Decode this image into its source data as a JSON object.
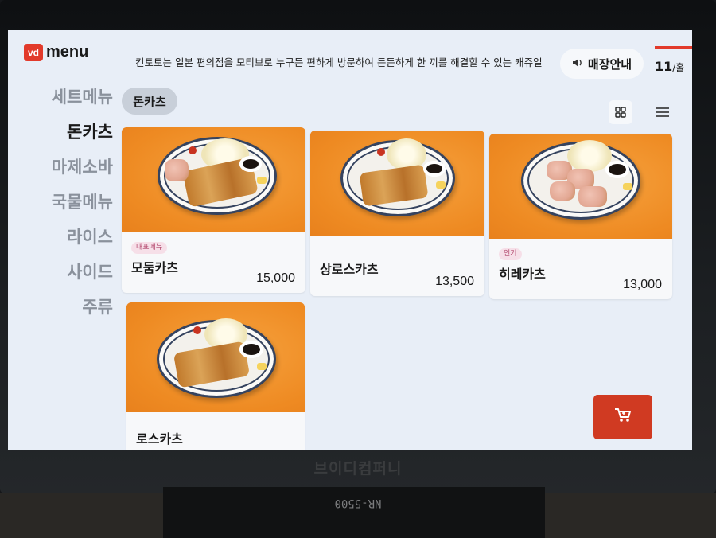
{
  "header": {
    "logo_badge": "vd",
    "logo_word": "menu",
    "notice": "킨토토는 일본 편의점을 모티브로 누구든 편하게 방문하여 든든하게 한 끼를 해결할 수 있는 캐쥬얼",
    "store_info_label": "매장안내",
    "table_number": "11",
    "table_suffix": "/홀"
  },
  "sidebar": {
    "items": [
      {
        "label": "세트메뉴"
      },
      {
        "label": "돈카츠"
      },
      {
        "label": "마제소바"
      },
      {
        "label": "국물메뉴"
      },
      {
        "label": "라이스"
      },
      {
        "label": "사이드"
      },
      {
        "label": "주류"
      }
    ],
    "active_index": 1
  },
  "subcategory": {
    "label": "돈카츠"
  },
  "menu_items": [
    {
      "name": "모둠카츠",
      "price": "15,000",
      "badge": "대표메뉴"
    },
    {
      "name": "상로스카츠",
      "price": "13,500",
      "badge": ""
    },
    {
      "name": "히레카츠",
      "price": "13,000",
      "badge": "인기"
    },
    {
      "name": "로스카츠",
      "price": "",
      "badge": ""
    }
  ],
  "bezel": {
    "brand": "브이디컴퍼니",
    "model": "NR-5500"
  },
  "colors": {
    "accent": "#d03a22",
    "photo_background": "#f3922a",
    "screen_background": "#e8eef7"
  },
  "icons": {
    "store_info": "speaker-icon",
    "view_grid": "grid-view-icon",
    "view_list": "list-view-icon",
    "cart": "cart-icon"
  }
}
